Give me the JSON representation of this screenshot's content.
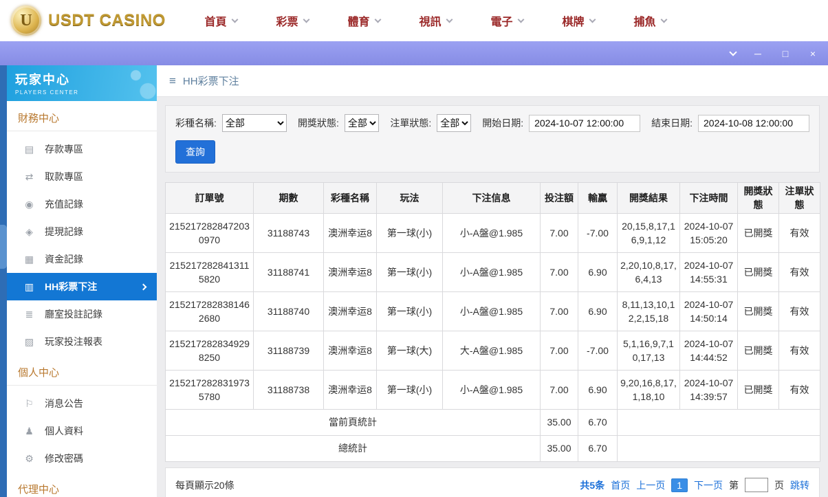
{
  "colors": {
    "accent_blue": "#1a6fd8",
    "active_menu_blue": "#1377d4",
    "purple_bar": "#9198ec",
    "nav_red": "#9a2727",
    "logo_gold": "#c19a33",
    "sidebar_header_blue": "#29a8e2",
    "section_heading_orange": "#b8782e"
  },
  "top_nav": {
    "logo_letter": "U",
    "logo_text": "USDT CASINO",
    "items": [
      {
        "label": "首頁",
        "name": "nav-item-home"
      },
      {
        "label": "彩票",
        "name": "nav-item-lottery"
      },
      {
        "label": "體育",
        "name": "nav-item-sports"
      },
      {
        "label": "視訊",
        "name": "nav-item-live-video"
      },
      {
        "label": "電子",
        "name": "nav-item-slots"
      },
      {
        "label": "棋牌",
        "name": "nav-item-board-games"
      },
      {
        "label": "捕魚",
        "name": "nav-item-fishing"
      }
    ]
  },
  "window_controls": {
    "minimize_glyph": "─",
    "maximize_glyph": "□",
    "close_glyph": "×"
  },
  "sidebar": {
    "title": "玩家中心",
    "subtitle": "PLAYERS CENTER",
    "finance": {
      "label": "財務中心",
      "items": [
        {
          "label": "存款專區",
          "name": "sidebar-item-deposit",
          "icon_name": "deposit-icon",
          "icon_glyph": "▤",
          "active": false
        },
        {
          "label": "取款專區",
          "name": "sidebar-item-withdraw",
          "icon_name": "withdraw-icon",
          "icon_glyph": "⇄",
          "active": false
        },
        {
          "label": "充值記錄",
          "name": "sidebar-item-recharge-records",
          "icon_name": "recharge-icon",
          "icon_glyph": "◉",
          "active": false
        },
        {
          "label": "提現記錄",
          "name": "sidebar-item-cashout-records",
          "icon_name": "cashout-icon",
          "icon_glyph": "◈",
          "active": false
        },
        {
          "label": "資金記錄",
          "name": "sidebar-item-fund-records",
          "icon_name": "funds-icon",
          "icon_glyph": "▦",
          "active": false
        },
        {
          "label": "HH彩票下注",
          "name": "sidebar-item-hh-lottery-bets",
          "icon_name": "lottery-bet-icon",
          "icon_glyph": "▥",
          "active": true
        },
        {
          "label": "廳室投註記錄",
          "name": "sidebar-item-hall-bet-records",
          "icon_name": "hall-records-icon",
          "icon_glyph": "≣",
          "active": false
        },
        {
          "label": "玩家投注報表",
          "name": "sidebar-item-player-bet-report",
          "icon_name": "report-icon",
          "icon_glyph": "▨",
          "active": false
        }
      ]
    },
    "personal": {
      "label": "個人中心",
      "items": [
        {
          "label": "消息公告",
          "name": "sidebar-item-announcements",
          "icon_name": "announcement-icon",
          "icon_glyph": "⚐",
          "active": false
        },
        {
          "label": "個人資料",
          "name": "sidebar-item-profile",
          "icon_name": "user-icon",
          "icon_glyph": "♟",
          "active": false
        },
        {
          "label": "修改密碼",
          "name": "sidebar-item-change-password",
          "icon_name": "gear-icon",
          "icon_glyph": "⚙",
          "active": false
        }
      ]
    },
    "agent": {
      "label": "代理中心"
    }
  },
  "breadcrumb": {
    "title": "HH彩票下注"
  },
  "filters": {
    "lottery_label": "彩種名稱:",
    "lottery_value": "全部",
    "draw_status_label": "開獎狀態:",
    "draw_status_value": "全部",
    "bet_status_label": "注單狀態:",
    "bet_status_value": "全部",
    "start_date_label": "開始日期:",
    "start_date_value": "2024-10-07 12:00:00",
    "end_date_label": "結束日期:",
    "end_date_value": "2024-10-08 12:00:00",
    "search_button": "查詢"
  },
  "table": {
    "headers": [
      {
        "label": "訂單號"
      },
      {
        "label": "期數"
      },
      {
        "label": "彩種名稱"
      },
      {
        "label": "玩法"
      },
      {
        "label": "下注信息"
      },
      {
        "label": "投注額"
      },
      {
        "label": "輸贏"
      },
      {
        "label": "開獎結果"
      },
      {
        "label": "下注時間"
      },
      {
        "label": "開獎狀態"
      },
      {
        "label": "注單狀態"
      }
    ],
    "rows": [
      {
        "order_id": "2152172828472030970",
        "period": "31188743",
        "lottery": "澳洲幸运8",
        "play": "第一球(小)",
        "bet_info": "小-A盤@1.985",
        "amount": "7.00",
        "win_loss": "-7.00",
        "result": "20,15,8,17,16,9,1,12",
        "bet_time": "2024-10-07 15:05:20",
        "draw_status": "已開獎",
        "bet_status": "有效"
      },
      {
        "order_id": "2152172828413115820",
        "period": "31188741",
        "lottery": "澳洲幸运8",
        "play": "第一球(小)",
        "bet_info": "小-A盤@1.985",
        "amount": "7.00",
        "win_loss": "6.90",
        "result": "2,20,10,8,17,6,4,13",
        "bet_time": "2024-10-07 14:55:31",
        "draw_status": "已開獎",
        "bet_status": "有效"
      },
      {
        "order_id": "2152172828381462680",
        "period": "31188740",
        "lottery": "澳洲幸运8",
        "play": "第一球(小)",
        "bet_info": "小-A盤@1.985",
        "amount": "7.00",
        "win_loss": "6.90",
        "result": "8,11,13,10,12,2,15,18",
        "bet_time": "2024-10-07 14:50:14",
        "draw_status": "已開獎",
        "bet_status": "有效"
      },
      {
        "order_id": "2152172828349298250",
        "period": "31188739",
        "lottery": "澳洲幸运8",
        "play": "第一球(大)",
        "bet_info": "大-A盤@1.985",
        "amount": "7.00",
        "win_loss": "-7.00",
        "result": "5,1,16,9,7,10,17,13",
        "bet_time": "2024-10-07 14:44:52",
        "draw_status": "已開獎",
        "bet_status": "有效"
      },
      {
        "order_id": "2152172828319735780",
        "period": "31188738",
        "lottery": "澳洲幸运8",
        "play": "第一球(小)",
        "bet_info": "小-A盤@1.985",
        "amount": "7.00",
        "win_loss": "6.90",
        "result": "9,20,16,8,17,1,18,10",
        "bet_time": "2024-10-07 14:39:57",
        "draw_status": "已開獎",
        "bet_status": "有效"
      }
    ],
    "page_summary": {
      "label": "當前頁統計",
      "amount": "35.00",
      "win_loss": "6.70"
    },
    "total_summary": {
      "label": "總統計",
      "amount": "35.00",
      "win_loss": "6.70"
    }
  },
  "footer": {
    "page_size_text": "每頁顯示20條",
    "total_text": "共5条",
    "first_page": "首页",
    "prev_page": "上一页",
    "current_page": "1",
    "next_page": "下一页",
    "jump_prefix": "第",
    "jump_suffix": "页",
    "jump_action": "跳转",
    "jump_value": ""
  }
}
